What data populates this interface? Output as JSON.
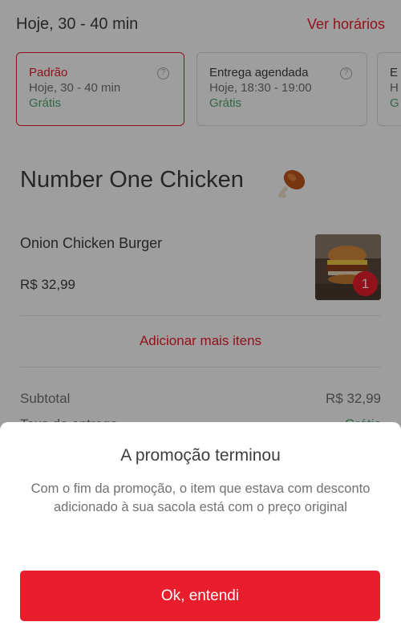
{
  "header": {
    "eta_title": "Hoje, 30 - 40 min",
    "schedule_link": "Ver horários"
  },
  "delivery_options": [
    {
      "name": "Padrão",
      "time": "Hoje, 30 - 40 min",
      "price": "Grátis",
      "selected": true
    },
    {
      "name": "Entrega agendada",
      "time": "Hoje, 18:30 - 19:00",
      "price": "Grátis",
      "selected": false
    },
    {
      "name": "E",
      "time": "H",
      "price": "G",
      "selected": false
    }
  ],
  "restaurant": {
    "name": "Number One Chicken",
    "icon": "chicken-leg-icon"
  },
  "cart_item": {
    "name": "Onion Chicken Burger",
    "price": "R$ 32,99",
    "quantity": "1"
  },
  "add_more_label": "Adicionar mais itens",
  "summary": {
    "subtotal_label": "Subtotal",
    "subtotal_value": "R$ 32,99",
    "fee_label": "Taxa de entrega",
    "fee_value": "Grátis"
  },
  "modal": {
    "title": "A promoção terminou",
    "message": "Com o fim da promoção, o item que estava com desconto adicionado à sua sacola está com o preço original",
    "button_label": "Ok, entendi"
  },
  "colors": {
    "brand_red": "#ea1d2c",
    "free_green": "#50a773",
    "text_dark": "#3e3e3e",
    "text_muted": "#717171"
  }
}
